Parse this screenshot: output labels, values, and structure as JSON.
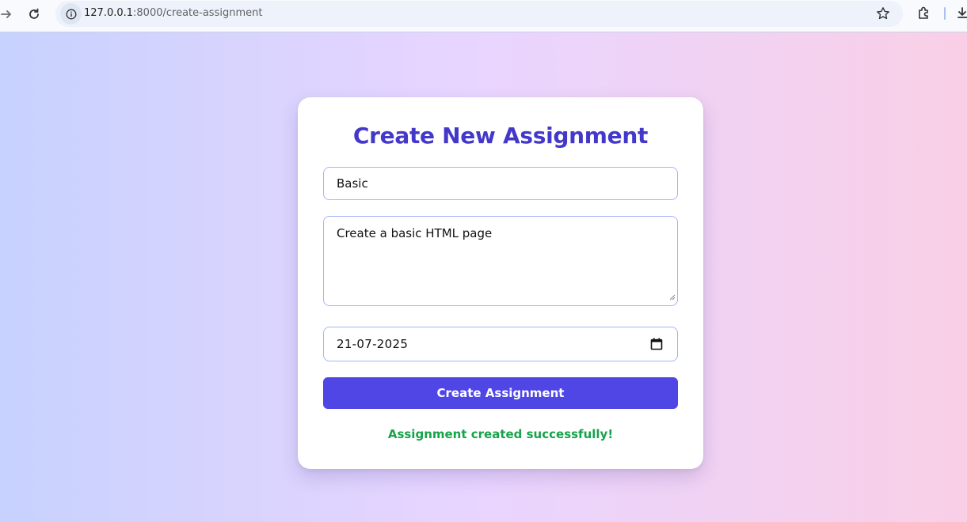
{
  "browser": {
    "url_host": "127.0.0.1",
    "url_path": ":8000/create-assignment",
    "icons": [
      "forward-icon",
      "reload-icon",
      "site-info-icon",
      "bookmark-star-icon",
      "extensions-icon",
      "download-icon"
    ]
  },
  "form": {
    "heading": "Create New Assignment",
    "title_value": "Basic",
    "description_value": "Create a basic HTML page",
    "due_date_value": "21-07-2025",
    "submit_label": "Create Assignment",
    "status_message": "Assignment created successfully!"
  },
  "colors": {
    "heading": "#4338ca",
    "button": "#4f46e5",
    "success": "#16a34a",
    "field_border": "#a5b4fc"
  }
}
